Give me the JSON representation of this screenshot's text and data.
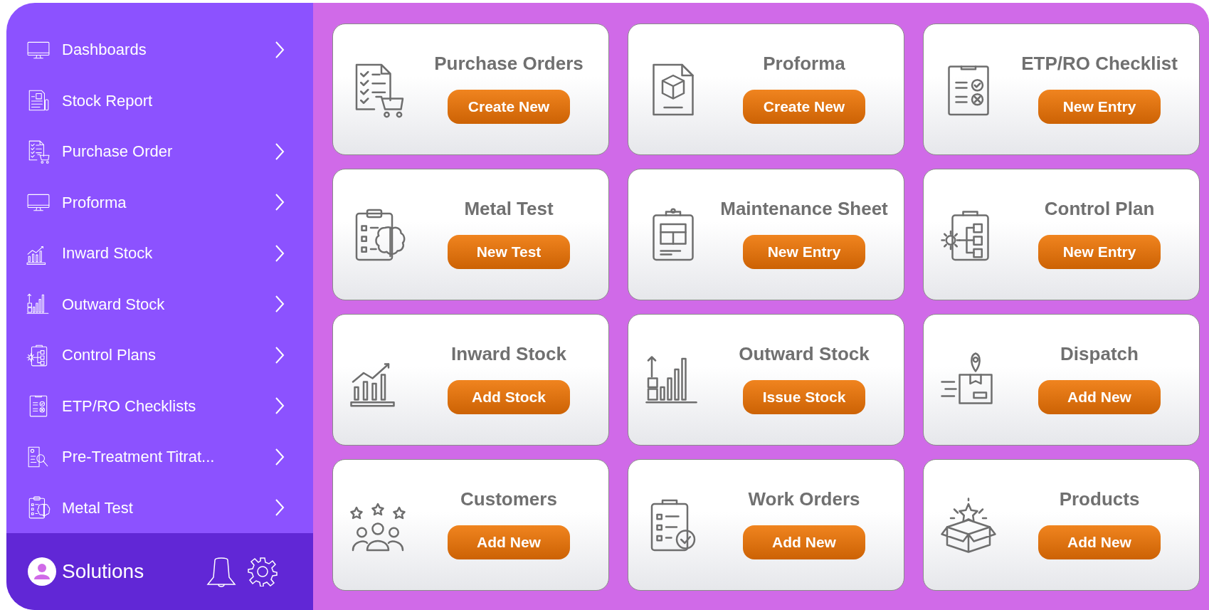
{
  "sidebar": {
    "items": [
      {
        "label": "Dashboards",
        "has_submenu": true
      },
      {
        "label": "Stock Report",
        "has_submenu": false
      },
      {
        "label": "Purchase Order",
        "has_submenu": true
      },
      {
        "label": "Proforma",
        "has_submenu": true
      },
      {
        "label": "Inward Stock",
        "has_submenu": true
      },
      {
        "label": "Outward Stock",
        "has_submenu": true
      },
      {
        "label": "Control Plans",
        "has_submenu": true
      },
      {
        "label": "ETP/RO Checklists",
        "has_submenu": true
      },
      {
        "label": "Pre-Treatment Titrat...",
        "has_submenu": true
      },
      {
        "label": "Metal Test",
        "has_submenu": true
      }
    ]
  },
  "footer": {
    "user": "Solutions"
  },
  "cards": [
    {
      "title": "Purchase Orders",
      "button": "Create New"
    },
    {
      "title": "Proforma",
      "button": "Create New"
    },
    {
      "title": "ETP/RO Checklist",
      "button": "New Entry"
    },
    {
      "title": "Metal Test",
      "button": "New Test"
    },
    {
      "title": "Maintenance Sheet",
      "button": "New Entry"
    },
    {
      "title": "Control Plan",
      "button": "New Entry"
    },
    {
      "title": "Inward Stock",
      "button": "Add Stock"
    },
    {
      "title": "Outward Stock",
      "button": "Issue Stock"
    },
    {
      "title": "Dispatch",
      "button": "Add New"
    },
    {
      "title": "Customers",
      "button": "Add New"
    },
    {
      "title": "Work Orders",
      "button": "Add New"
    },
    {
      "title": "Products",
      "button": "Add New"
    }
  ]
}
